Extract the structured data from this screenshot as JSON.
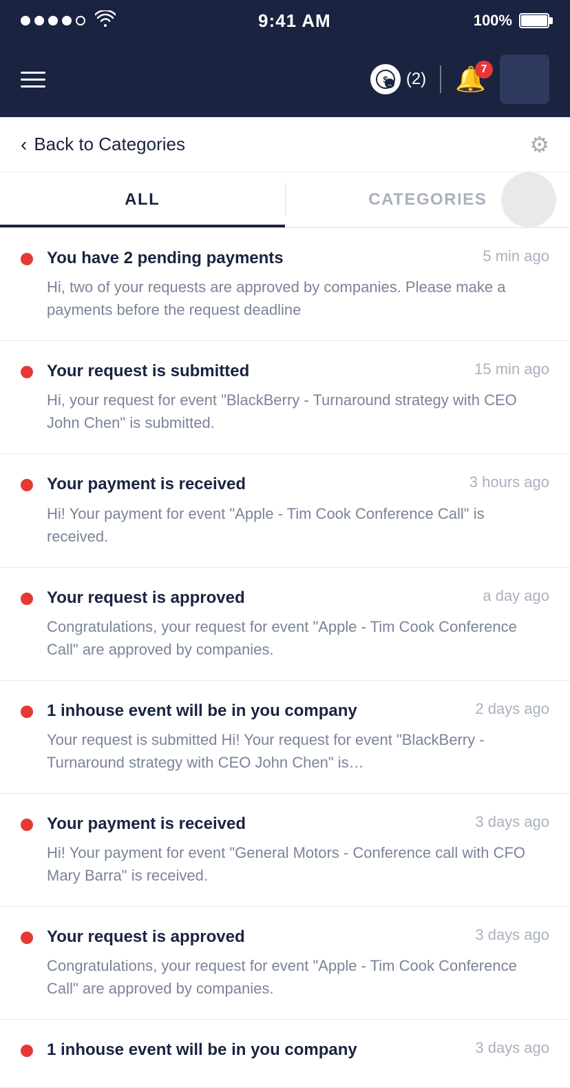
{
  "statusBar": {
    "time": "9:41 AM",
    "battery": "100%"
  },
  "header": {
    "coinCount": "(2)",
    "bellBadge": "7"
  },
  "backNav": {
    "backLabel": "Back to Categories"
  },
  "tabs": [
    {
      "label": "ALL",
      "active": true
    },
    {
      "label": "CATEGORIES",
      "active": false
    }
  ],
  "notifications": [
    {
      "title": "You have 2 pending payments",
      "time": "5 min ago",
      "body": "Hi, two of your requests are approved by companies. Please make a payments before the request deadline"
    },
    {
      "title": "Your request is submitted",
      "time": "15 min ago",
      "body": "Hi, your request for event \"BlackBerry - Turnaround strategy with CEO John Chen\" is submitted."
    },
    {
      "title": "Your payment is received",
      "time": "3 hours ago",
      "body": "Hi! Your payment for event \"Apple - Tim Cook Conference Call\" is received."
    },
    {
      "title": "Your request is approved",
      "time": "a day ago",
      "body": "Congratulations, your request for event \"Apple - Tim Cook Conference Call\" are approved by companies."
    },
    {
      "title": "1 inhouse event will be in you company",
      "time": "2 days ago",
      "body": "Your request is submitted Hi! Your request for  event \"BlackBerry - Turnaround strategy with CEO John Chen\" is…"
    },
    {
      "title": "Your payment is received",
      "time": "3 days ago",
      "body": "Hi! Your payment for event \"General Motors - Conference call with CFO Mary Barra\" is received."
    },
    {
      "title": "Your request is approved",
      "time": "3 days ago",
      "body": "Congratulations, your request for event \"Apple - Tim Cook Conference Call\" are approved by companies."
    },
    {
      "title": "1 inhouse event will be in you company",
      "time": "3 days ago",
      "body": ""
    }
  ]
}
